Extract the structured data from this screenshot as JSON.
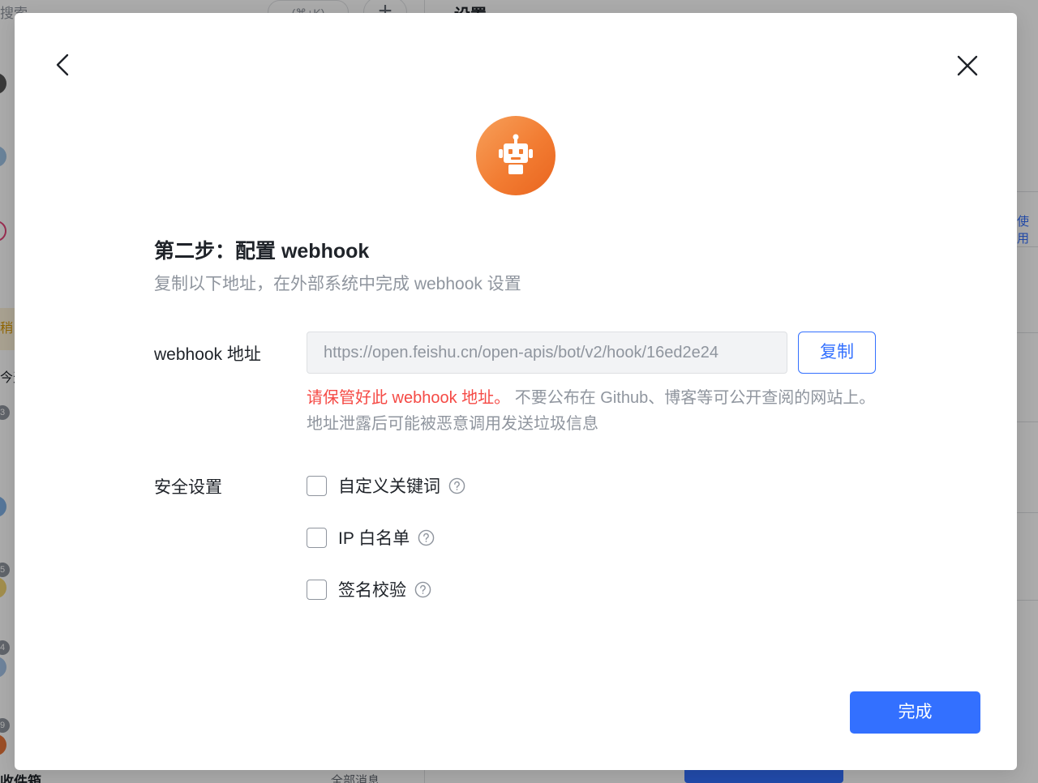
{
  "background": {
    "search_placeholder": "搜索",
    "shortcut": "(⌘+K)",
    "plus": "+",
    "page_title": "设置",
    "today": "今天",
    "yellow_tag": "稍",
    "badges": [
      "3",
      "5",
      "4",
      "9"
    ],
    "inbox": "收件箱",
    "all_messages": "全部消息",
    "right_link": "使用"
  },
  "modal": {
    "step_title": "第二步：配置 webhook",
    "step_desc": "复制以下地址，在外部系统中完成 webhook 设置",
    "webhook_label": "webhook 地址",
    "webhook_url": "https://open.feishu.cn/open-apis/bot/v2/hook/16ed2e24",
    "copy_label": "复制",
    "warning_red": "请保管好此 webhook 地址。",
    "warning_rest": " 不要公布在 Github、博客等可公开查阅的网站上。地址泄露后可能被恶意调用发送垃圾信息",
    "security_label": "安全设置",
    "options": [
      {
        "label": "自定义关键词",
        "checked": false
      },
      {
        "label": "IP 白名单",
        "checked": false
      },
      {
        "label": "签名校验",
        "checked": false
      }
    ],
    "done_label": "完成"
  },
  "colors": {
    "accent": "#3370ff",
    "warning": "#f54a45",
    "bot_orange": "#f27c32"
  },
  "icons": [
    "back-arrow-icon",
    "close-icon",
    "robot-icon",
    "help-circle-icon"
  ]
}
